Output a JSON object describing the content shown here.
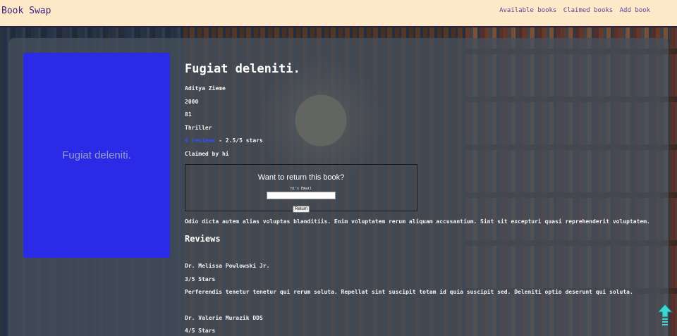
{
  "header": {
    "brand": "Book Swap",
    "nav": [
      "Available books",
      "Claimed books",
      "Add book"
    ]
  },
  "book": {
    "cover_text": "Fugiat deleniti.",
    "title": "Fugiat deleniti.",
    "author": "Aditya Zieme",
    "year": "2000",
    "pages": "81",
    "genre": "Thriller",
    "reviews_link": "4 reviews",
    "rating_text": " - 2.5/5 stars",
    "claimed_by": "Claimed by hi",
    "description": "Odio dicta autem alias voluptas blanditiis. Enim voluptatem rerum aliquam accusantium. Sint sit excepturi quasi reprehenderit voluptatem."
  },
  "return_form": {
    "question": "Want to return this book?",
    "email_label": "hi's Email",
    "email_value": "",
    "button": "Return"
  },
  "reviews": {
    "heading": "Reviews",
    "items": [
      {
        "author": "Dr. Melissa Powlowski Jr.",
        "stars": "3/5 Stars",
        "text": "Perferendis tenetur tenetur qui rerum soluta. Repellat sint suscipit totam id quia suscipit sed. Deleniti optio deserunt qui soluta."
      },
      {
        "author": "Dr. Valerie Murazik DDS",
        "stars": "4/5 Stars",
        "text": ""
      }
    ]
  },
  "icons": {
    "scroll_top": "arrow-up-icon"
  },
  "colors": {
    "header_bg": "#fde8c8",
    "cover_bg": "#2b2ae6",
    "link": "#2f4fff",
    "scroll_button": "#3fd6d0"
  }
}
